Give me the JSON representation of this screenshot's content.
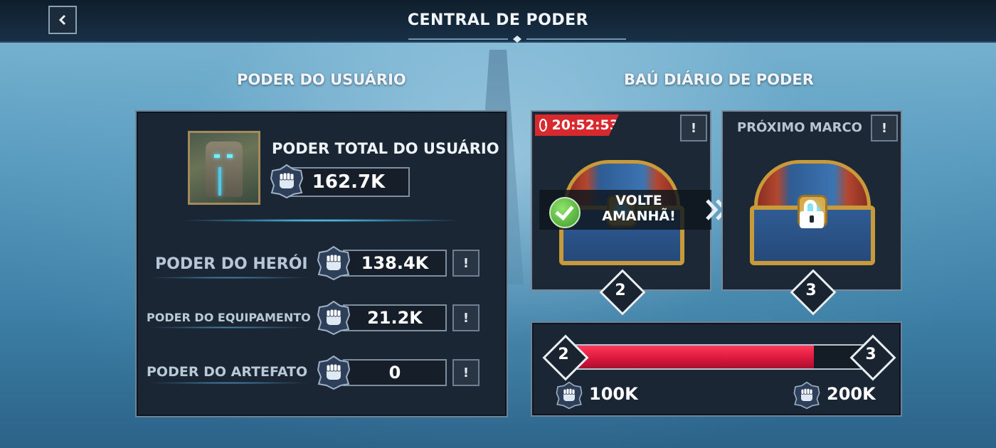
{
  "header": {
    "title": "CENTRAL DE PODER"
  },
  "left": {
    "section_title": "PODER DO USUÁRIO",
    "total": {
      "label": "PODER TOTAL DO USUÁRIO",
      "value": "162.7K"
    },
    "stats": [
      {
        "label": "PODER DO HERÓI",
        "value": "138.4K",
        "info": "!"
      },
      {
        "label": "PODER DO EQUIPAMENTO",
        "value": "21.2K",
        "info": "!"
      },
      {
        "label": "PODER DO ARTEFATO",
        "value": "0",
        "info": "!"
      }
    ]
  },
  "right": {
    "section_title": "BAÚ DIÁRIO DE PODER",
    "current_chest": {
      "timer": "20:52:53",
      "status": "VOLTE AMANHÃ!",
      "level": "2",
      "info": "!"
    },
    "next_chest": {
      "title": "PRÓXIMO MARCO",
      "level": "3",
      "info": "!"
    },
    "progress": {
      "from_level": "2",
      "to_level": "3",
      "fraction": 0.82,
      "from_value": "100K",
      "to_value": "200K"
    }
  },
  "colors": {
    "accent_red": "#d8173c",
    "timer_red": "#d8292e",
    "panel": "#1b2634",
    "border": "#7a8a9a"
  },
  "icons": [
    "back-arrow-icon",
    "fist-icon",
    "timer-icon",
    "check-icon",
    "lock-icon",
    "double-chevron-icon",
    "chest-icon"
  ]
}
